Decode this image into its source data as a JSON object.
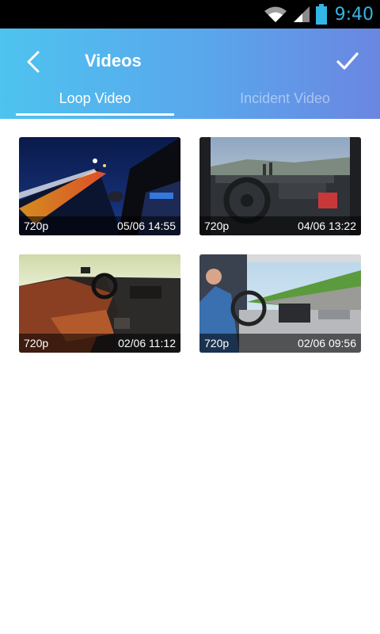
{
  "status_bar": {
    "time": "9:40",
    "icons": [
      "wifi-icon",
      "signal-icon",
      "battery-icon"
    ]
  },
  "header": {
    "title": "Videos"
  },
  "tabs": [
    {
      "label": "Loop Video",
      "active": true
    },
    {
      "label": "Incident Video",
      "active": false
    }
  ],
  "colors": {
    "accent": "#33b5e5",
    "gradient_start": "#4ec3ef",
    "gradient_end": "#6b86e1"
  },
  "videos": [
    {
      "resolution": "720p",
      "date": "05/06 14:55"
    },
    {
      "resolution": "720p",
      "date": "04/06 13:22"
    },
    {
      "resolution": "720p",
      "date": "02/06 11:12"
    },
    {
      "resolution": "720p",
      "date": "02/06 09:56"
    }
  ]
}
